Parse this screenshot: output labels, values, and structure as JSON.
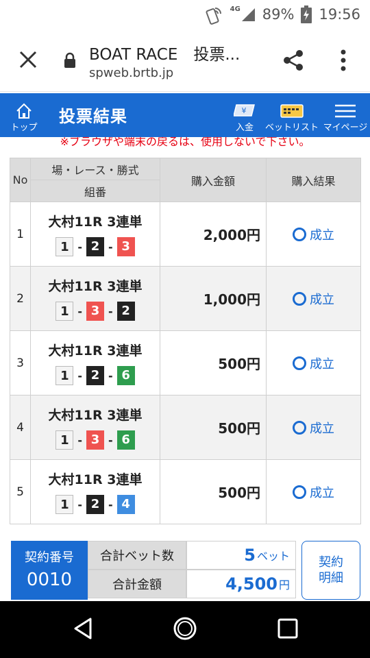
{
  "status_bar": {
    "network": "4G",
    "battery": "89%",
    "time": "19:56"
  },
  "url_bar": {
    "title": "BOAT RACE　投票...",
    "host": "spweb.brtb.jp"
  },
  "header": {
    "home_label": "トップ",
    "title": "投票結果",
    "deposit_label": "入金",
    "betlist_label": "ベットリスト",
    "mypage_label": "マイページ"
  },
  "warning": "※ブラウザや端末の戻るは、使用しないで下さい。",
  "table": {
    "col_no": "No",
    "col_race": "場・レース・勝式",
    "col_combo": "組番",
    "col_amount": "購入金額",
    "col_result": "購入結果"
  },
  "bets": [
    {
      "no": "1",
      "race": "大村11R 3連単",
      "combo": [
        "1",
        "2",
        "3"
      ],
      "amount": "2,000円",
      "result": "成立"
    },
    {
      "no": "2",
      "race": "大村11R 3連単",
      "combo": [
        "1",
        "3",
        "2"
      ],
      "amount": "1,000円",
      "result": "成立"
    },
    {
      "no": "3",
      "race": "大村11R 3連単",
      "combo": [
        "1",
        "2",
        "6"
      ],
      "amount": "500円",
      "result": "成立"
    },
    {
      "no": "4",
      "race": "大村11R 3連単",
      "combo": [
        "1",
        "3",
        "6"
      ],
      "amount": "500円",
      "result": "成立"
    },
    {
      "no": "5",
      "race": "大村11R 3連単",
      "combo": [
        "1",
        "2",
        "4"
      ],
      "amount": "500円",
      "result": "成立"
    }
  ],
  "boat_colors": {
    "1": {
      "bg": "#f4f4f4",
      "fg": "#222222"
    },
    "2": {
      "bg": "#222222",
      "fg": "#ffffff"
    },
    "3": {
      "bg": "#ef5350",
      "fg": "#ffffff"
    },
    "4": {
      "bg": "#3f8de0",
      "fg": "#ffffff"
    },
    "6": {
      "bg": "#2e9d4e",
      "fg": "#ffffff"
    }
  },
  "summary": {
    "contract_label": "契約番号",
    "contract_number": "0010",
    "bet_count_label": "合計ベット数",
    "bet_count_value": "5",
    "bet_count_unit": "ベット",
    "total_label": "合計金額",
    "total_value": "4,500",
    "total_unit": "円",
    "detail_button_line1": "契約",
    "detail_button_line2": "明細"
  },
  "colors": {
    "brand_blue": "#1a6bd1",
    "warning_red": "#e60012"
  }
}
